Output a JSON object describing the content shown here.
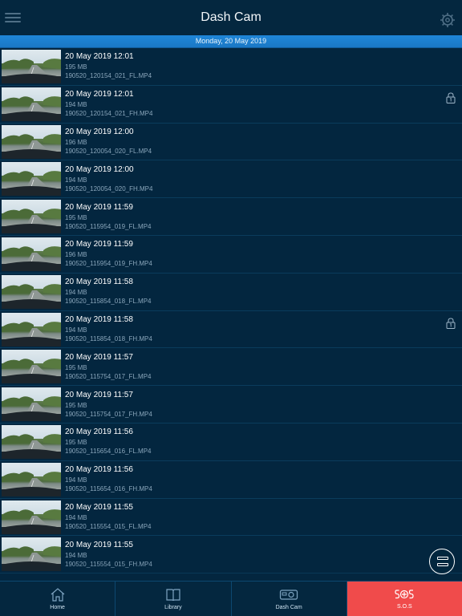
{
  "header": {
    "title": "Dash Cam"
  },
  "date_bar": {
    "label": "Monday, 20 May 2019"
  },
  "recordings": [
    {
      "date": "20 May 2019 12:01",
      "size": "195 MB",
      "file": "190520_120154_021_FL.MP4",
      "locked": false
    },
    {
      "date": "20 May 2019 12:01",
      "size": "194 MB",
      "file": "190520_120154_021_FH.MP4",
      "locked": true
    },
    {
      "date": "20 May 2019 12:00",
      "size": "196 MB",
      "file": "190520_120054_020_FL.MP4",
      "locked": false
    },
    {
      "date": "20 May 2019 12:00",
      "size": "194 MB",
      "file": "190520_120054_020_FH.MP4",
      "locked": false
    },
    {
      "date": "20 May 2019 11:59",
      "size": "195 MB",
      "file": "190520_115954_019_FL.MP4",
      "locked": false
    },
    {
      "date": "20 May 2019 11:59",
      "size": "196 MB",
      "file": "190520_115954_019_FH.MP4",
      "locked": false
    },
    {
      "date": "20 May 2019 11:58",
      "size": "194 MB",
      "file": "190520_115854_018_FL.MP4",
      "locked": false
    },
    {
      "date": "20 May 2019 11:58",
      "size": "194 MB",
      "file": "190520_115854_018_FH.MP4",
      "locked": true
    },
    {
      "date": "20 May 2019 11:57",
      "size": "195 MB",
      "file": "190520_115754_017_FL.MP4",
      "locked": false
    },
    {
      "date": "20 May 2019 11:57",
      "size": "195 MB",
      "file": "190520_115754_017_FH.MP4",
      "locked": false
    },
    {
      "date": "20 May 2019 11:56",
      "size": "195 MB",
      "file": "190520_115654_016_FL.MP4",
      "locked": false
    },
    {
      "date": "20 May 2019 11:56",
      "size": "194 MB",
      "file": "190520_115654_016_FH.MP4",
      "locked": false
    },
    {
      "date": "20 May 2019 11:55",
      "size": "194 MB",
      "file": "190520_115554_015_FL.MP4",
      "locked": false
    },
    {
      "date": "20 May 2019 11:55",
      "size": "194 MB",
      "file": "190520_115554_015_FH.MP4",
      "locked": false
    }
  ],
  "tabs": [
    {
      "label": "Home",
      "icon": "home-icon"
    },
    {
      "label": "Library",
      "icon": "library-icon"
    },
    {
      "label": "Dash Cam",
      "icon": "dash-cam-icon"
    },
    {
      "label": "S.O.S",
      "icon": "sos-icon"
    }
  ],
  "colors": {
    "background": "#03263f",
    "date_bar": "#1f86d8",
    "sos": "#f04b4b"
  }
}
